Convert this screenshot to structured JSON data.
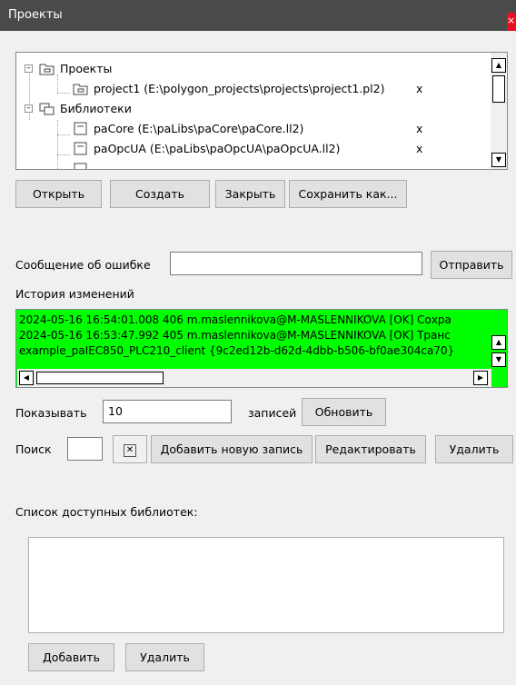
{
  "window": {
    "title": "Проекты",
    "close": "×"
  },
  "tree": {
    "root": "Проекты",
    "project1": "project1 (E:\\polygon_projects\\projects\\project1.pl2)",
    "libraries": "Библиотеки",
    "paCore": "paCore (E:\\paLibs\\paCore\\paCore.ll2)",
    "paOpcUA": "paOpcUA (E:\\paLibs\\paOpcUA\\paOpcUA.ll2)",
    "remove_mark": "x"
  },
  "buttons": {
    "open": "Открыть",
    "create": "Создать",
    "close": "Закрыть",
    "save_as": "Сохранить как...",
    "send": "Отправить",
    "refresh": "Обновить",
    "add_record": "Добавить новую запись",
    "edit": "Редактировать",
    "delete": "Удалить",
    "add_lib": "Добавить",
    "delete_lib": "Удалить"
  },
  "error_report": {
    "label": "Сообщение об ошибке",
    "value": ""
  },
  "history": {
    "label": "История изменений",
    "lines": [
      "2024-05-16 16:54:01.008 406 m.maslennikova@M-MASLENNIKOVA [OK] Сохра",
      "2024-05-16 16:53:47.992 405 m.maslennikova@M-MASLENNIKOVA [OK] Транс",
      "example_paIEC850_PLC210_client {9c2ed12b-d62d-4dbb-b506-bf0ae304ca70}"
    ],
    "highlight_color": "#00ff00"
  },
  "show": {
    "label": "Показывать",
    "value": "10",
    "suffix": "записей"
  },
  "search": {
    "label": "Поиск",
    "value": "",
    "clear_glyph": "✕"
  },
  "libraries_available": {
    "label": "Список доступных библиотек:"
  },
  "colors": {
    "titlebar": "#4a4a4a",
    "close": "#e81123",
    "background": "#f0f0f0"
  }
}
